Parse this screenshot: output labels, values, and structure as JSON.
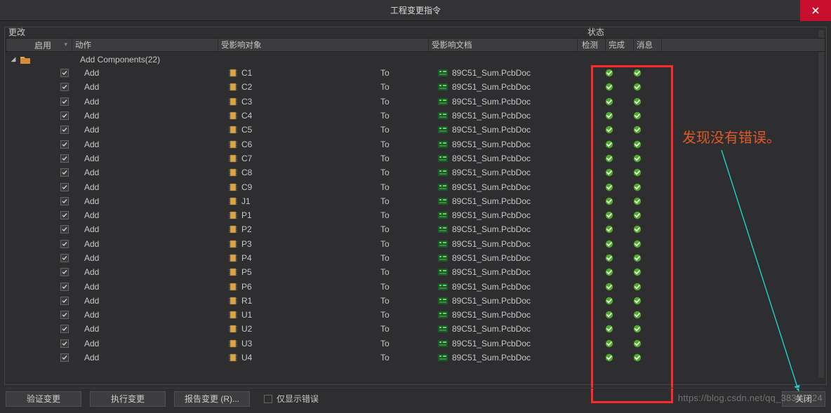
{
  "title": "工程变更指令",
  "sections": {
    "changes": "更改",
    "status": "状态"
  },
  "headers": {
    "enable": "启用",
    "action": "动作",
    "affected_obj": "受影响对象",
    "affected_doc": "受影响文档",
    "check": "检测",
    "done": "完成",
    "msg": "消息"
  },
  "group": {
    "label": "Add Components(22)"
  },
  "to_label": "To",
  "doc_name": "89C51_Sum.PcbDoc",
  "action_label": "Add",
  "rows": [
    {
      "obj": "C1"
    },
    {
      "obj": "C2"
    },
    {
      "obj": "C3"
    },
    {
      "obj": "C4"
    },
    {
      "obj": "C5"
    },
    {
      "obj": "C6"
    },
    {
      "obj": "C7"
    },
    {
      "obj": "C8"
    },
    {
      "obj": "C9"
    },
    {
      "obj": "J1"
    },
    {
      "obj": "P1"
    },
    {
      "obj": "P2"
    },
    {
      "obj": "P3"
    },
    {
      "obj": "P4"
    },
    {
      "obj": "P5"
    },
    {
      "obj": "P6"
    },
    {
      "obj": "R1"
    },
    {
      "obj": "U1"
    },
    {
      "obj": "U2"
    },
    {
      "obj": "U3"
    },
    {
      "obj": "U4"
    }
  ],
  "buttons": {
    "validate": "验证变更",
    "execute": "执行变更",
    "report": "报告变更 (R)...",
    "only_errors": "仅显示错误",
    "close": "关闭"
  },
  "annotation": "发现没有错误。",
  "watermark": "https://blog.csdn.net/qq_38351824"
}
